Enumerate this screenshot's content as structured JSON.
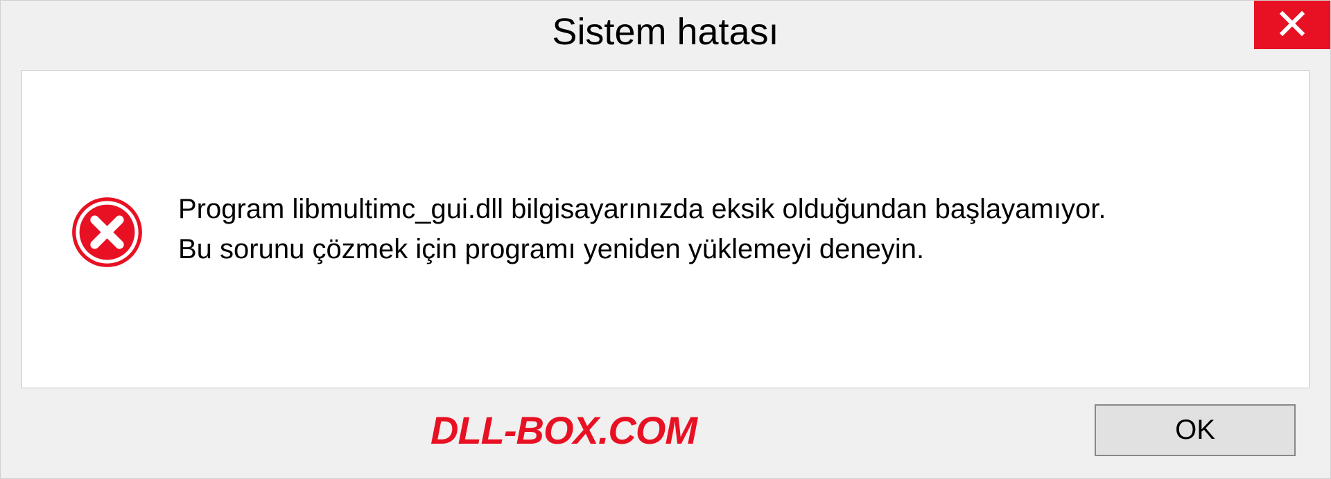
{
  "dialog": {
    "title": "Sistem hatası",
    "message_line1": "Program libmultimc_gui.dll bilgisayarınızda eksik olduğundan başlayamıyor.",
    "message_line2": "Bu sorunu çözmek için programı yeniden yüklemeyi deneyin.",
    "ok_label": "OK"
  },
  "watermark": "DLL-BOX.COM",
  "icons": {
    "close": "close-icon",
    "error": "error-circle-x-icon"
  },
  "colors": {
    "close_bg": "#e81123",
    "error_red": "#e81123",
    "panel_bg": "#ffffff",
    "dialog_bg": "#f0f0f0"
  }
}
